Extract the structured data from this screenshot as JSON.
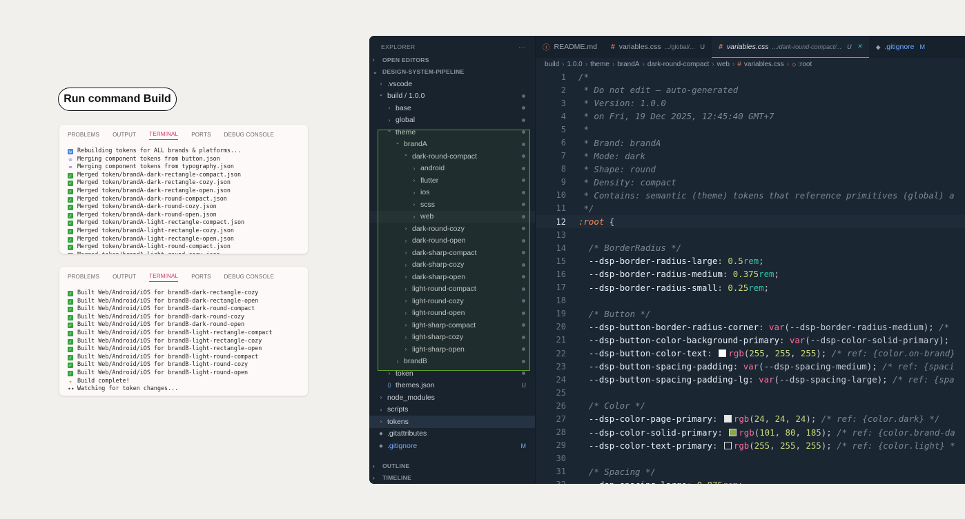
{
  "command_label": "Run command Build",
  "terminal_tabs": [
    "PROBLEMS",
    "OUTPUT",
    "TERMINAL",
    "PORTS",
    "DEBUG CONSOLE"
  ],
  "terminal1": {
    "lines": [
      {
        "icon": "refresh",
        "text": "Rebuilding tokens for ALL brands & platforms..."
      },
      {
        "icon": "link",
        "text": "Merging component tokens from button.json"
      },
      {
        "icon": "link",
        "text": "Merging component tokens from typography.json"
      },
      {
        "icon": "check",
        "text": "Merged token/brandA-dark-rectangle-compact.json"
      },
      {
        "icon": "check",
        "text": "Merged token/brandA-dark-rectangle-cozy.json"
      },
      {
        "icon": "check",
        "text": "Merged token/brandA-dark-rectangle-open.json"
      },
      {
        "icon": "check",
        "text": "Merged token/brandA-dark-round-compact.json"
      },
      {
        "icon": "check",
        "text": "Merged token/brandA-dark-round-cozy.json"
      },
      {
        "icon": "check",
        "text": "Merged token/brandA-dark-round-open.json"
      },
      {
        "icon": "check",
        "text": "Merged token/brandA-light-rectangle-compact.json"
      },
      {
        "icon": "check",
        "text": "Merged token/brandA-light-rectangle-cozy.json"
      },
      {
        "icon": "check",
        "text": "Merged token/brandA-light-rectangle-open.json"
      },
      {
        "icon": "check",
        "text": "Merged token/brandA-light-round-compact.json"
      },
      {
        "icon": "check",
        "text": "Merged token/brandA-light-round-cozy.json"
      }
    ]
  },
  "terminal2": {
    "lines": [
      {
        "icon": "check",
        "text": "Built Web/Android/iOS for brandB-dark-rectangle-cozy"
      },
      {
        "icon": "check",
        "text": "Built Web/Android/iOS for brandB-dark-rectangle-open"
      },
      {
        "icon": "check",
        "text": "Built Web/Android/iOS for brandB-dark-round-compact"
      },
      {
        "icon": "check",
        "text": "Built Web/Android/iOS for brandB-dark-round-cozy"
      },
      {
        "icon": "check",
        "text": "Built Web/Android/iOS for brandB-dark-round-open"
      },
      {
        "icon": "check",
        "text": "Built Web/Android/iOS for brandB-light-rectangle-compact"
      },
      {
        "icon": "check",
        "text": "Built Web/Android/iOS for brandB-light-rectangle-cozy"
      },
      {
        "icon": "check",
        "text": "Built Web/Android/iOS for brandB-light-rectangle-open"
      },
      {
        "icon": "check",
        "text": "Built Web/Android/iOS for brandB-light-round-compact"
      },
      {
        "icon": "check",
        "text": "Built Web/Android/iOS for brandB-light-round-cozy"
      },
      {
        "icon": "check",
        "text": "Built Web/Android/iOS for brandB-light-round-open"
      },
      {
        "icon": "party",
        "text": "Build complete!"
      },
      {
        "icon": "eyes",
        "text": "Watching for token changes..."
      }
    ]
  },
  "explorer": {
    "title": "EXPLORER",
    "more": "···",
    "open_editors": "OPEN EDITORS",
    "project": "DESIGN-SYSTEM-PIPELINE",
    "items": [
      {
        "label": ".vscode",
        "depth": 0,
        "type": "folder",
        "open": false,
        "mark": ""
      },
      {
        "label": "build / 1.0.0",
        "depth": 0,
        "type": "folder",
        "open": true,
        "mark": "dot"
      },
      {
        "label": "base",
        "depth": 1,
        "type": "folder",
        "open": false,
        "mark": "dot"
      },
      {
        "label": "global",
        "depth": 1,
        "type": "folder",
        "open": false,
        "mark": "dot"
      },
      {
        "label": "theme",
        "depth": 1,
        "type": "folder",
        "open": true,
        "mark": "dot"
      },
      {
        "label": "brandA",
        "depth": 2,
        "type": "folder",
        "open": true,
        "mark": "dot"
      },
      {
        "label": "dark-round-compact",
        "depth": 3,
        "type": "folder",
        "open": true,
        "mark": "dot"
      },
      {
        "label": "android",
        "depth": 4,
        "type": "folder",
        "open": false,
        "mark": "dot"
      },
      {
        "label": "flutter",
        "depth": 4,
        "type": "folder",
        "open": false,
        "mark": "dot"
      },
      {
        "label": "ios",
        "depth": 4,
        "type": "folder",
        "open": false,
        "mark": "dot"
      },
      {
        "label": "scss",
        "depth": 4,
        "type": "folder",
        "open": false,
        "mark": "dot"
      },
      {
        "label": "web",
        "depth": 4,
        "type": "folder",
        "open": false,
        "mark": "dot",
        "hl": true
      },
      {
        "label": "dark-round-cozy",
        "depth": 3,
        "type": "folder",
        "open": false,
        "mark": "dot"
      },
      {
        "label": "dark-round-open",
        "depth": 3,
        "type": "folder",
        "open": false,
        "mark": "dot"
      },
      {
        "label": "dark-sharp-compact",
        "depth": 3,
        "type": "folder",
        "open": false,
        "mark": "dot"
      },
      {
        "label": "dark-sharp-cozy",
        "depth": 3,
        "type": "folder",
        "open": false,
        "mark": "dot"
      },
      {
        "label": "dark-sharp-open",
        "depth": 3,
        "type": "folder",
        "open": false,
        "mark": "dot"
      },
      {
        "label": "light-round-compact",
        "depth": 3,
        "type": "folder",
        "open": false,
        "mark": "dot"
      },
      {
        "label": "light-round-cozy",
        "depth": 3,
        "type": "folder",
        "open": false,
        "mark": "dot"
      },
      {
        "label": "light-round-open",
        "depth": 3,
        "type": "folder",
        "open": false,
        "mark": "dot"
      },
      {
        "label": "light-sharp-compact",
        "depth": 3,
        "type": "folder",
        "open": false,
        "mark": "dot"
      },
      {
        "label": "light-sharp-cozy",
        "depth": 3,
        "type": "folder",
        "open": false,
        "mark": "dot"
      },
      {
        "label": "light-sharp-open",
        "depth": 3,
        "type": "folder",
        "open": false,
        "mark": "dot"
      },
      {
        "label": "brandB",
        "depth": 2,
        "type": "folder",
        "open": false,
        "mark": "dot"
      },
      {
        "label": "token",
        "depth": 1,
        "type": "folder",
        "open": false,
        "mark": "dot"
      },
      {
        "label": "themes.json",
        "depth": 1,
        "type": "json",
        "open": false,
        "mark": "U"
      },
      {
        "label": "node_modules",
        "depth": 0,
        "type": "folder",
        "open": false,
        "mark": ""
      },
      {
        "label": "scripts",
        "depth": 0,
        "type": "folder",
        "open": false,
        "mark": ""
      },
      {
        "label": "tokens",
        "depth": 0,
        "type": "folder",
        "open": false,
        "mark": "",
        "sel": true
      },
      {
        "label": ".gitattributes",
        "depth": 0,
        "type": "git",
        "open": false,
        "mark": ""
      },
      {
        "label": ".gitignore",
        "depth": 0,
        "type": "git",
        "open": false,
        "mark": "M",
        "blue": true
      }
    ],
    "outline": "OUTLINE",
    "timeline": "TIMELINE"
  },
  "tabs": [
    {
      "icon": "info",
      "name": "README.md",
      "dir": "",
      "status": "",
      "active": false
    },
    {
      "icon": "hash",
      "name": "variables.css",
      "dir": ".../global/...",
      "status": "U",
      "active": false
    },
    {
      "icon": "hash",
      "name": "variables.css",
      "dir": ".../dark-round-compact/...",
      "status": "U",
      "active": true
    },
    {
      "icon": "git",
      "name": ".gitignore",
      "dir": "",
      "status": "M",
      "active": false
    }
  ],
  "breadcrumbs": [
    "build",
    "1.0.0",
    "theme",
    "brandA",
    "dark-round-compact",
    "web",
    "variables.css",
    ":root"
  ],
  "code_lines": [
    [
      [
        "c-com",
        "/*"
      ]
    ],
    [
      [
        "c-com",
        " * Do not edit — auto-generated"
      ]
    ],
    [
      [
        "c-com",
        " * Version: 1.0.0"
      ]
    ],
    [
      [
        "c-com",
        " * on Fri, 19 Dec 2025, 12:45:40 GMT+7"
      ]
    ],
    [
      [
        "c-com",
        " *"
      ]
    ],
    [
      [
        "c-com",
        " * Brand: brandA"
      ]
    ],
    [
      [
        "c-com",
        " * Mode: dark"
      ]
    ],
    [
      [
        "c-com",
        " * Shape: round"
      ]
    ],
    [
      [
        "c-com",
        " * Density: compact"
      ]
    ],
    [
      [
        "c-com",
        " * Contains: semantic (theme) tokens that reference primitives (global) a"
      ]
    ],
    [
      [
        "c-com",
        " */"
      ]
    ],
    [
      [
        "c-sel",
        ":root"
      ],
      [
        "c-pun",
        " {"
      ]
    ],
    [],
    [
      [
        "c-com",
        "  /* BorderRadius */"
      ]
    ],
    [
      [
        "c-prop",
        "  --dsp-border-radius-large"
      ],
      [
        "c-pun",
        ": "
      ],
      [
        "c-num",
        "0.5"
      ],
      [
        "c-unit",
        "rem"
      ],
      [
        "c-pun",
        ";"
      ]
    ],
    [
      [
        "c-prop",
        "  --dsp-border-radius-medium"
      ],
      [
        "c-pun",
        ": "
      ],
      [
        "c-num",
        "0.375"
      ],
      [
        "c-unit",
        "rem"
      ],
      [
        "c-pun",
        ";"
      ]
    ],
    [
      [
        "c-prop",
        "  --dsp-border-radius-small"
      ],
      [
        "c-pun",
        ": "
      ],
      [
        "c-num",
        "0.25"
      ],
      [
        "c-unit",
        "rem"
      ],
      [
        "c-pun",
        ";"
      ]
    ],
    [],
    [
      [
        "c-com",
        "  /* Button */"
      ]
    ],
    [
      [
        "c-prop",
        "  --dsp-button-border-radius-corner"
      ],
      [
        "c-pun",
        ": "
      ],
      [
        "c-fn",
        "var"
      ],
      [
        "c-pun",
        "(--dsp-border-radius-medium); "
      ],
      [
        "c-com",
        "/*"
      ]
    ],
    [
      [
        "c-prop",
        "  --dsp-button-color-background-primary"
      ],
      [
        "c-pun",
        ": "
      ],
      [
        "c-fn",
        "var"
      ],
      [
        "c-pun",
        "(--dsp-color-solid-primary);"
      ]
    ],
    [
      [
        "c-prop",
        "  --dsp-button-color-text"
      ],
      [
        "c-pun",
        ": "
      ],
      [
        "sw",
        "#ffffff"
      ],
      [
        "c-fn",
        "rgb"
      ],
      [
        "c-pun",
        "("
      ],
      [
        "c-num",
        "255"
      ],
      [
        "c-pun",
        ", "
      ],
      [
        "c-num",
        "255"
      ],
      [
        "c-pun",
        ", "
      ],
      [
        "c-num",
        "255"
      ],
      [
        "c-pun",
        "); "
      ],
      [
        "c-com",
        "/* ref: {color.on-brand}"
      ]
    ],
    [
      [
        "c-prop",
        "  --dsp-button-spacing-padding"
      ],
      [
        "c-pun",
        ": "
      ],
      [
        "c-fn",
        "var"
      ],
      [
        "c-pun",
        "(--dsp-spacing-medium); "
      ],
      [
        "c-com",
        "/* ref: {spaci"
      ]
    ],
    [
      [
        "c-prop",
        "  --dsp-button-spacing-padding-lg"
      ],
      [
        "c-pun",
        ": "
      ],
      [
        "c-fn",
        "var"
      ],
      [
        "c-pun",
        "(--dsp-spacing-large); "
      ],
      [
        "c-com",
        "/* ref: {spa"
      ]
    ],
    [],
    [
      [
        "c-com",
        "  /* Color */"
      ]
    ],
    [
      [
        "c-prop",
        "  --dsp-color-page-primary"
      ],
      [
        "c-pun",
        ": "
      ],
      [
        "sw",
        "#e8e8e8"
      ],
      [
        "c-fn",
        "rgb"
      ],
      [
        "c-pun",
        "("
      ],
      [
        "c-num",
        "24"
      ],
      [
        "c-pun",
        ", "
      ],
      [
        "c-num",
        "24"
      ],
      [
        "c-pun",
        ", "
      ],
      [
        "c-num",
        "24"
      ],
      [
        "c-pun",
        "); "
      ],
      [
        "c-com",
        "/* ref: {color.dark} */"
      ]
    ],
    [
      [
        "c-prop",
        "  --dsp-color-solid-primary"
      ],
      [
        "c-pun",
        ": "
      ],
      [
        "sw",
        "#8aa845"
      ],
      [
        "c-fn",
        "rgb"
      ],
      [
        "c-pun",
        "("
      ],
      [
        "c-num",
        "101"
      ],
      [
        "c-pun",
        ", "
      ],
      [
        "c-num",
        "80"
      ],
      [
        "c-pun",
        ", "
      ],
      [
        "c-num",
        "185"
      ],
      [
        "c-pun",
        "); "
      ],
      [
        "c-com",
        "/* ref: {color.brand-da"
      ]
    ],
    [
      [
        "c-prop",
        "  --dsp-color-text-primary"
      ],
      [
        "c-pun",
        ": "
      ],
      [
        "sw",
        "#1b2633"
      ],
      [
        "c-fn",
        "rgb"
      ],
      [
        "c-pun",
        "("
      ],
      [
        "c-num",
        "255"
      ],
      [
        "c-pun",
        ", "
      ],
      [
        "c-num",
        "255"
      ],
      [
        "c-pun",
        ", "
      ],
      [
        "c-num",
        "255"
      ],
      [
        "c-pun",
        "); "
      ],
      [
        "c-com",
        "/* ref: {color.light} *"
      ]
    ],
    [],
    [
      [
        "c-com",
        "  /* Spacing */"
      ]
    ],
    [
      [
        "c-prop",
        "  --dsp-spacing-large"
      ],
      [
        "c-pun",
        ": "
      ],
      [
        "c-num",
        "0.875"
      ],
      [
        "c-unit",
        "rem"
      ],
      [
        "c-pun",
        ";"
      ]
    ]
  ],
  "current_line": 12
}
